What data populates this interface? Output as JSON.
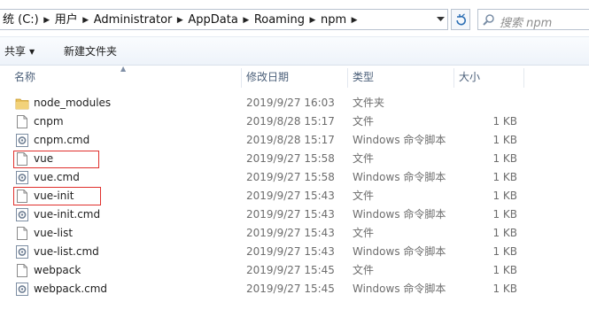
{
  "address": {
    "crumbs": [
      "统 (C:)",
      "用户",
      "Administrator",
      "AppData",
      "Roaming",
      "npm"
    ],
    "search_placeholder": "搜索 npm"
  },
  "toolbar": {
    "share_label": "共享",
    "new_folder_label": "新建文件夹"
  },
  "columns": {
    "name": "名称",
    "date": "修改日期",
    "type": "类型",
    "size": "大小"
  },
  "files": [
    {
      "name": "node_modules",
      "date": "2019/9/27 16:03",
      "type": "文件夹",
      "size": "",
      "icon": "folder-icon"
    },
    {
      "name": "cnpm",
      "date": "2019/8/28 15:17",
      "type": "文件",
      "size": "1 KB",
      "icon": "file-icon"
    },
    {
      "name": "cnpm.cmd",
      "date": "2019/8/28 15:17",
      "type": "Windows 命令脚本",
      "size": "1 KB",
      "icon": "cmd-script-icon"
    },
    {
      "name": "vue",
      "date": "2019/9/27 15:58",
      "type": "文件",
      "size": "1 KB",
      "icon": "file-icon"
    },
    {
      "name": "vue.cmd",
      "date": "2019/9/27 15:58",
      "type": "Windows 命令脚本",
      "size": "1 KB",
      "icon": "cmd-script-icon"
    },
    {
      "name": "vue-init",
      "date": "2019/9/27 15:43",
      "type": "文件",
      "size": "1 KB",
      "icon": "file-icon"
    },
    {
      "name": "vue-init.cmd",
      "date": "2019/9/27 15:43",
      "type": "Windows 命令脚本",
      "size": "1 KB",
      "icon": "cmd-script-icon"
    },
    {
      "name": "vue-list",
      "date": "2019/9/27 15:43",
      "type": "文件",
      "size": "1 KB",
      "icon": "file-icon"
    },
    {
      "name": "vue-list.cmd",
      "date": "2019/9/27 15:43",
      "type": "Windows 命令脚本",
      "size": "1 KB",
      "icon": "cmd-script-icon"
    },
    {
      "name": "webpack",
      "date": "2019/9/27 15:45",
      "type": "文件",
      "size": "1 KB",
      "icon": "file-icon"
    },
    {
      "name": "webpack.cmd",
      "date": "2019/9/27 15:45",
      "type": "Windows 命令脚本",
      "size": "1 KB",
      "icon": "cmd-script-icon"
    }
  ],
  "colors": {
    "highlight_box": "#e0302c",
    "header_text": "#4c607a"
  }
}
